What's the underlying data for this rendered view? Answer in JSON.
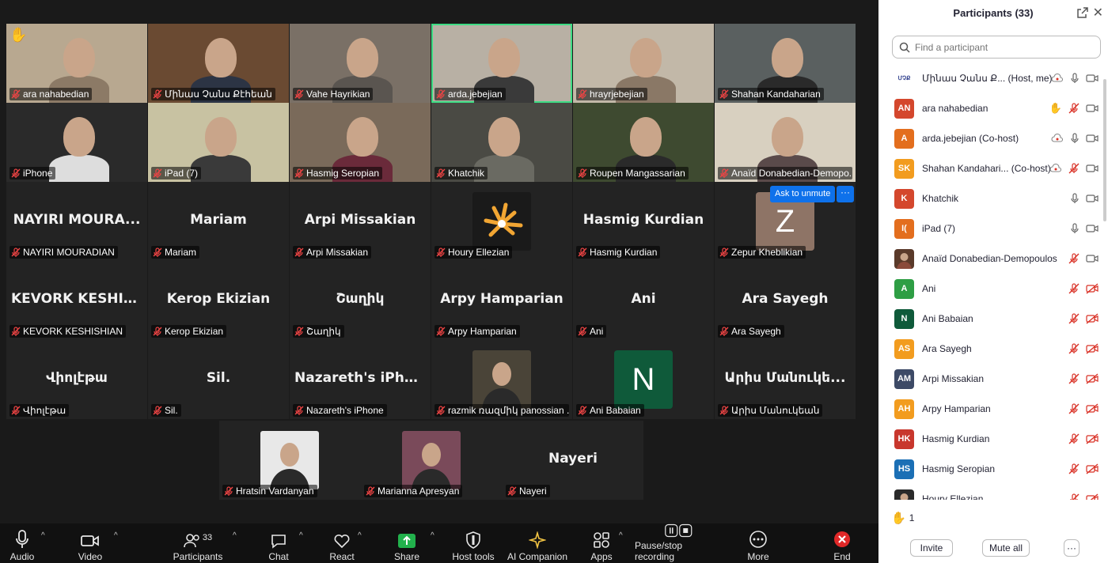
{
  "gallery": {
    "tiles": [
      {
        "label": "ara nahabedian",
        "big": "",
        "video": true
      },
      {
        "label": "Մինաս Չանս Քէհեան",
        "big": "",
        "video": true
      },
      {
        "label": "Vahe Hayrikian",
        "big": "",
        "video": true
      },
      {
        "label": "arda.jebejian",
        "big": "",
        "video": true
      },
      {
        "label": "hrayrjebejian",
        "big": "",
        "video": true
      },
      {
        "label": "Shahan Kandaharian",
        "big": "",
        "video": true
      },
      {
        "label": "iPhone",
        "big": "",
        "video": true
      },
      {
        "label": "iPad (7)",
        "big": "",
        "video": true
      },
      {
        "label": "Hasmig Seropian",
        "big": "",
        "video": true
      },
      {
        "label": "Khatchik",
        "big": "",
        "video": true
      },
      {
        "label": "Roupen Mangassarian",
        "big": "",
        "video": true
      },
      {
        "label": "Anaïd Donabedian-Demopo...",
        "big": "",
        "video": true
      },
      {
        "label": "NAYIRI MOURADIAN",
        "big": "NAYIRI MOURA..."
      },
      {
        "label": "Mariam",
        "big": "Mariam"
      },
      {
        "label": "Arpi Missakian",
        "big": "Arpi Missakian"
      },
      {
        "label": "Houry Ellezian",
        "big": ""
      },
      {
        "label": "Hasmig Kurdian",
        "big": "Hasmig Kurdian"
      },
      {
        "label": "Zepur Kheblikian",
        "big": ""
      },
      {
        "label": "KEVORK KESHISHIAN",
        "big": "KEVORK KESHIS..."
      },
      {
        "label": "Kerop Ekizian",
        "big": "Kerop Ekizian"
      },
      {
        "label": "Շաղիկ",
        "big": "Շաղիկ"
      },
      {
        "label": "Arpy Hamparian",
        "big": "Arpy Hamparian"
      },
      {
        "label": "Ani",
        "big": "Ani"
      },
      {
        "label": "Ara Sayegh",
        "big": "Ara Sayegh"
      },
      {
        "label": "Վիոլէթա",
        "big": "Վիոլէթա"
      },
      {
        "label": "Sil.",
        "big": "Sil."
      },
      {
        "label": "Nazareth's iPhone",
        "big": "Nazareth's iPhone"
      },
      {
        "label": "razmik ռազմիկ panossian ...",
        "big": ""
      },
      {
        "label": "Ani Babaian",
        "big": ""
      },
      {
        "label": "Արիս Մանուկեան",
        "big": "Արիս Մանուկե..."
      }
    ],
    "bottom": [
      {
        "label": "Hratsin Vardanyan",
        "big": ""
      },
      {
        "label": "Marianna Apresyan",
        "big": ""
      },
      {
        "label": "Nayeri",
        "big": "Nayeri"
      }
    ],
    "zepur_letter": "Z",
    "ani_letter": "N",
    "ask_unmute": "Ask to unmute",
    "more_dots": "···"
  },
  "toolbar": {
    "audio": "Audio",
    "video": "Video",
    "participants": "Participants",
    "participants_count": "33",
    "chat": "Chat",
    "react": "React",
    "share": "Share",
    "host_tools": "Host tools",
    "ai_companion": "AI Companion",
    "apps": "Apps",
    "pause_stop": "Pause/stop recording",
    "more": "More",
    "end": "End"
  },
  "panel": {
    "title": "Participants (33)",
    "search_placeholder": "Find a participant",
    "raised_count": "1",
    "invite": "Invite",
    "mute_all": "Mute all",
    "more": "···",
    "participants": [
      {
        "initials": "ՄՉՔ",
        "name": "Մինաս Չանս Ք... (Host, me)",
        "color": "#ffffff",
        "logo": true
      },
      {
        "initials": "AN",
        "name": "ara nahabedian",
        "color": "#d4472d",
        "hand": true
      },
      {
        "initials": "A",
        "name": "arda.jebejian (Co-host)",
        "color": "#e36e1e"
      },
      {
        "initials": "SK",
        "name": "Shahan Kandahari... (Co-host)",
        "color": "#f29c1f"
      },
      {
        "initials": "K",
        "name": "Khatchik",
        "color": "#d4472d"
      },
      {
        "initials": "I(",
        "name": "iPad (7)",
        "color": "#e36e1e"
      },
      {
        "initials": "",
        "name": "Anaïd Donabedian-Demopoulos",
        "color": "#5a3a2a"
      },
      {
        "initials": "A",
        "name": "Ani",
        "color": "#2e9e44"
      },
      {
        "initials": "N",
        "name": "Ani Babaian",
        "color": "#0f5a3a"
      },
      {
        "initials": "AS",
        "name": "Ara Sayegh",
        "color": "#f29c1f"
      },
      {
        "initials": "AM",
        "name": "Arpi Missakian",
        "color": "#3d4a66"
      },
      {
        "initials": "AH",
        "name": "Arpy Hamparian",
        "color": "#f29c1f"
      },
      {
        "initials": "HK",
        "name": "Hasmig Kurdian",
        "color": "#c8372d"
      },
      {
        "initials": "HS",
        "name": "Hasmig Seropian",
        "color": "#1b6fb5"
      },
      {
        "initials": "",
        "name": "Houry Ellezian",
        "color": "#2a2a2a"
      }
    ]
  }
}
